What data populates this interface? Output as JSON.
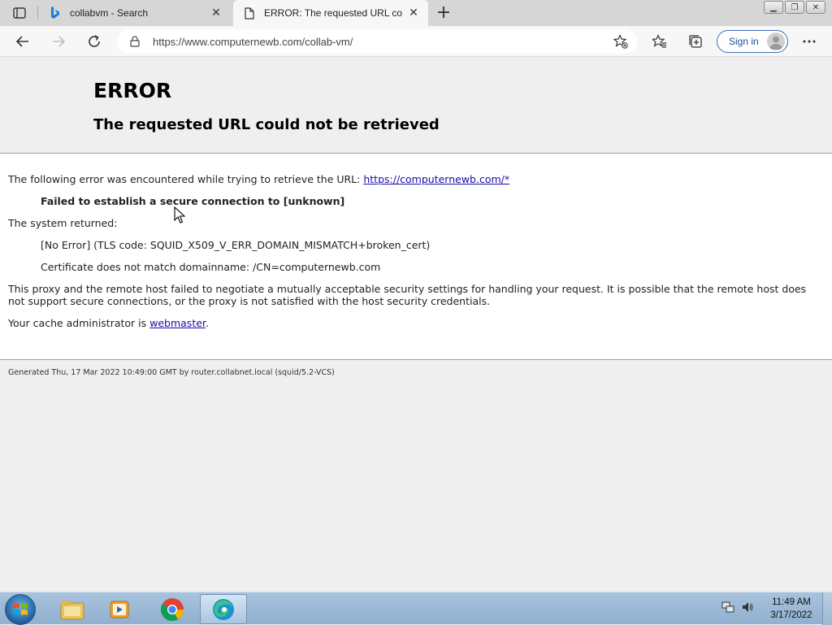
{
  "browser": {
    "tabs": [
      {
        "title": "collabvm - Search",
        "active": false,
        "icon": "bing-icon"
      },
      {
        "title": "ERROR: The requested URL could not be retrieved",
        "active": true,
        "icon": "page-icon"
      }
    ],
    "address_bar": {
      "url": "https://www.computernewb.com/collab-vm/"
    },
    "sign_in_label": "Sign in"
  },
  "page": {
    "heading": "ERROR",
    "subheading": "The requested URL could not be retrieved",
    "intro_text": "The following error was encountered while trying to retrieve the URL: ",
    "intro_link": "https://computernewb.com/*",
    "error_message": "Failed to establish a secure connection to [unknown]",
    "system_returned_label": "The system returned:",
    "system_returned_detail": "[No Error] (TLS code: SQUID_X509_V_ERR_DOMAIN_MISMATCH+broken_cert)",
    "certificate_detail": "Certificate does not match domainname: /CN=computernewb.com",
    "explanation": "This proxy and the remote host failed to negotiate a mutually acceptable security settings for handling your request. It is possible that the remote host does not support secure connections, or the proxy is not satisfied with the host security credentials.",
    "admin_prefix": "Your cache administrator is ",
    "admin_link": "webmaster",
    "admin_suffix": ".",
    "footer": "Generated Thu, 17 Mar 2022 10:49:00 GMT by router.collabnet.local (squid/5.2-VCS)"
  },
  "taskbar": {
    "apps": [
      "file-explorer-icon",
      "media-player-icon",
      "chrome-icon",
      "edge-icon"
    ],
    "clock_time": "11:49 AM",
    "clock_date": "3/17/2022"
  },
  "colors": {
    "link": "#1a0dab",
    "header_bg": "#efefef",
    "taskbar": "#9db9d6"
  }
}
